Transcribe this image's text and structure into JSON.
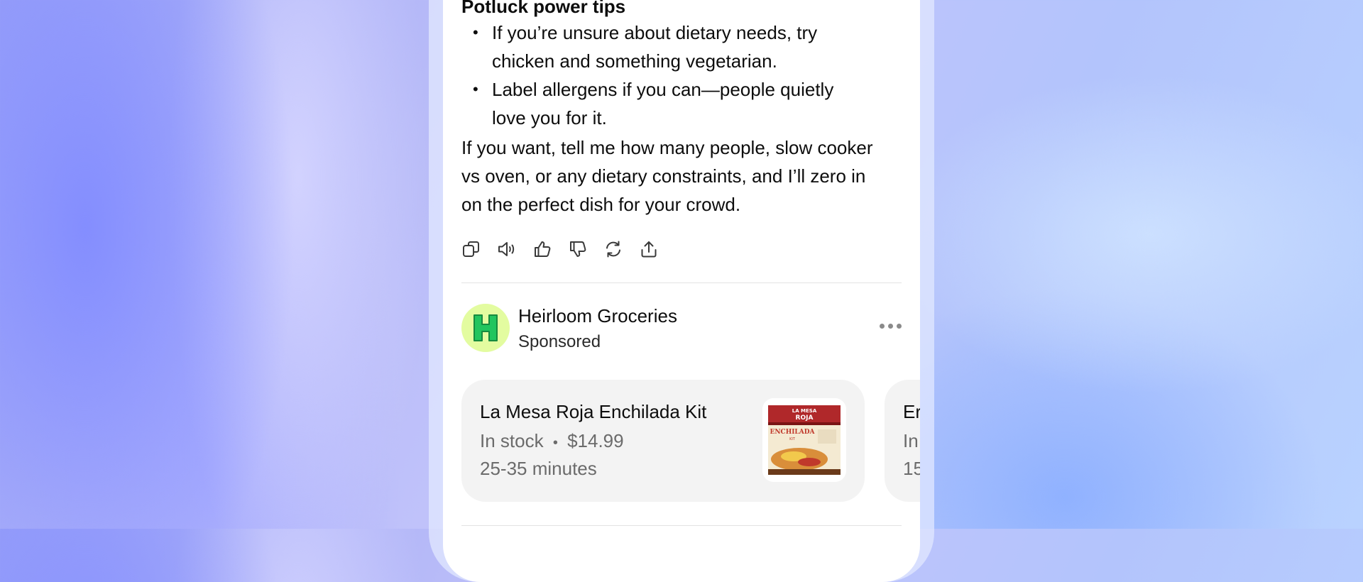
{
  "response": {
    "heading": "Potluck power tips",
    "tips": [
      "If you’re unsure about dietary needs, try chicken and something vegetarian.",
      "Label allergens if you can—people quietly love you for it."
    ],
    "bullet": "•",
    "paragraph": "If you want, tell me how many people, slow cooker vs oven, or any dietary constraints, and I’ll zero in on the perfect dish for your crowd."
  },
  "actions": [
    "copy-icon",
    "read-aloud-icon",
    "thumbs-up-icon",
    "thumbs-down-icon",
    "regenerate-icon",
    "share-icon"
  ],
  "ad": {
    "advertiser": "Heirloom Groceries",
    "sponsored_label": "Sponsored",
    "logo_color": "#22c55e",
    "logo_bg": "#e3fca0",
    "products": [
      {
        "title": "La Mesa Roja Enchilada Kit",
        "stock": "In stock",
        "separator": "•",
        "price": "$14.99",
        "eta": "25-35 minutes",
        "image_text": [
          "LA MESA",
          "ROJA",
          "ENCHILADA",
          "KIT"
        ]
      },
      {
        "title": "Er",
        "stock": "In",
        "eta": "15"
      }
    ]
  }
}
